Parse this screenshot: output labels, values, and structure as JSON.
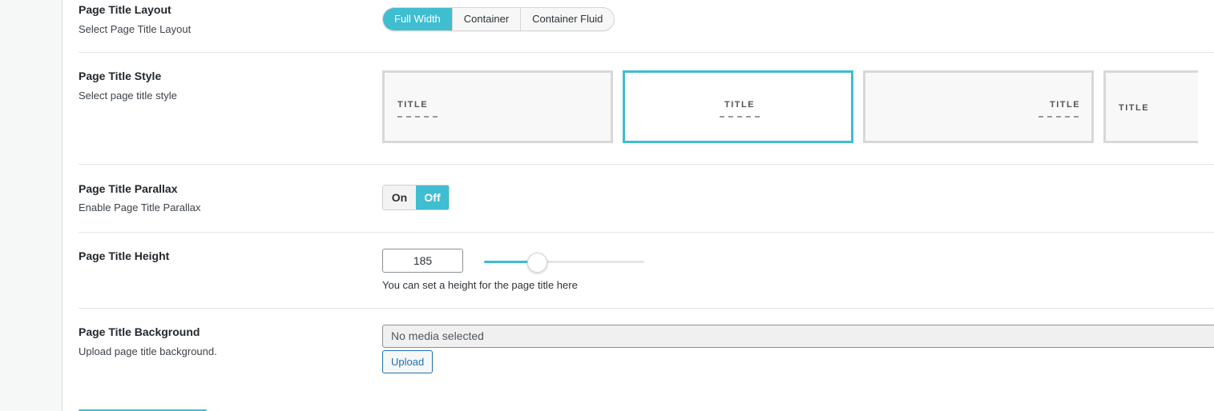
{
  "rows": {
    "layout": {
      "label": "Page Title Layout",
      "desc": "Select Page Title Layout",
      "options": [
        "Full Width",
        "Container",
        "Container Fluid"
      ],
      "selected": "Full Width"
    },
    "style": {
      "label": "Page Title Style",
      "desc": "Select page title style",
      "tiles": [
        {
          "title": "TITLE",
          "align": "left"
        },
        {
          "title": "TITLE",
          "align": "center"
        },
        {
          "title": "TITLE",
          "align": "right"
        },
        {
          "title": "TITLE",
          "align": "left-nodash"
        }
      ],
      "selected_index": 1
    },
    "parallax": {
      "label": "Page Title Parallax",
      "desc": "Enable Page Title Parallax",
      "on_label": "On",
      "off_label": "Off",
      "selected": "Off"
    },
    "height": {
      "label": "Page Title Height",
      "value": "185",
      "help": "You can set a height for the page title here",
      "slider_fraction": 0.33
    },
    "background": {
      "label": "Page Title Background",
      "desc": "Upload page title background.",
      "media_placeholder": "No media selected",
      "upload_label": "Upload"
    }
  },
  "colors": {
    "accent": "#3fbdd1",
    "link": "#2271b1"
  }
}
